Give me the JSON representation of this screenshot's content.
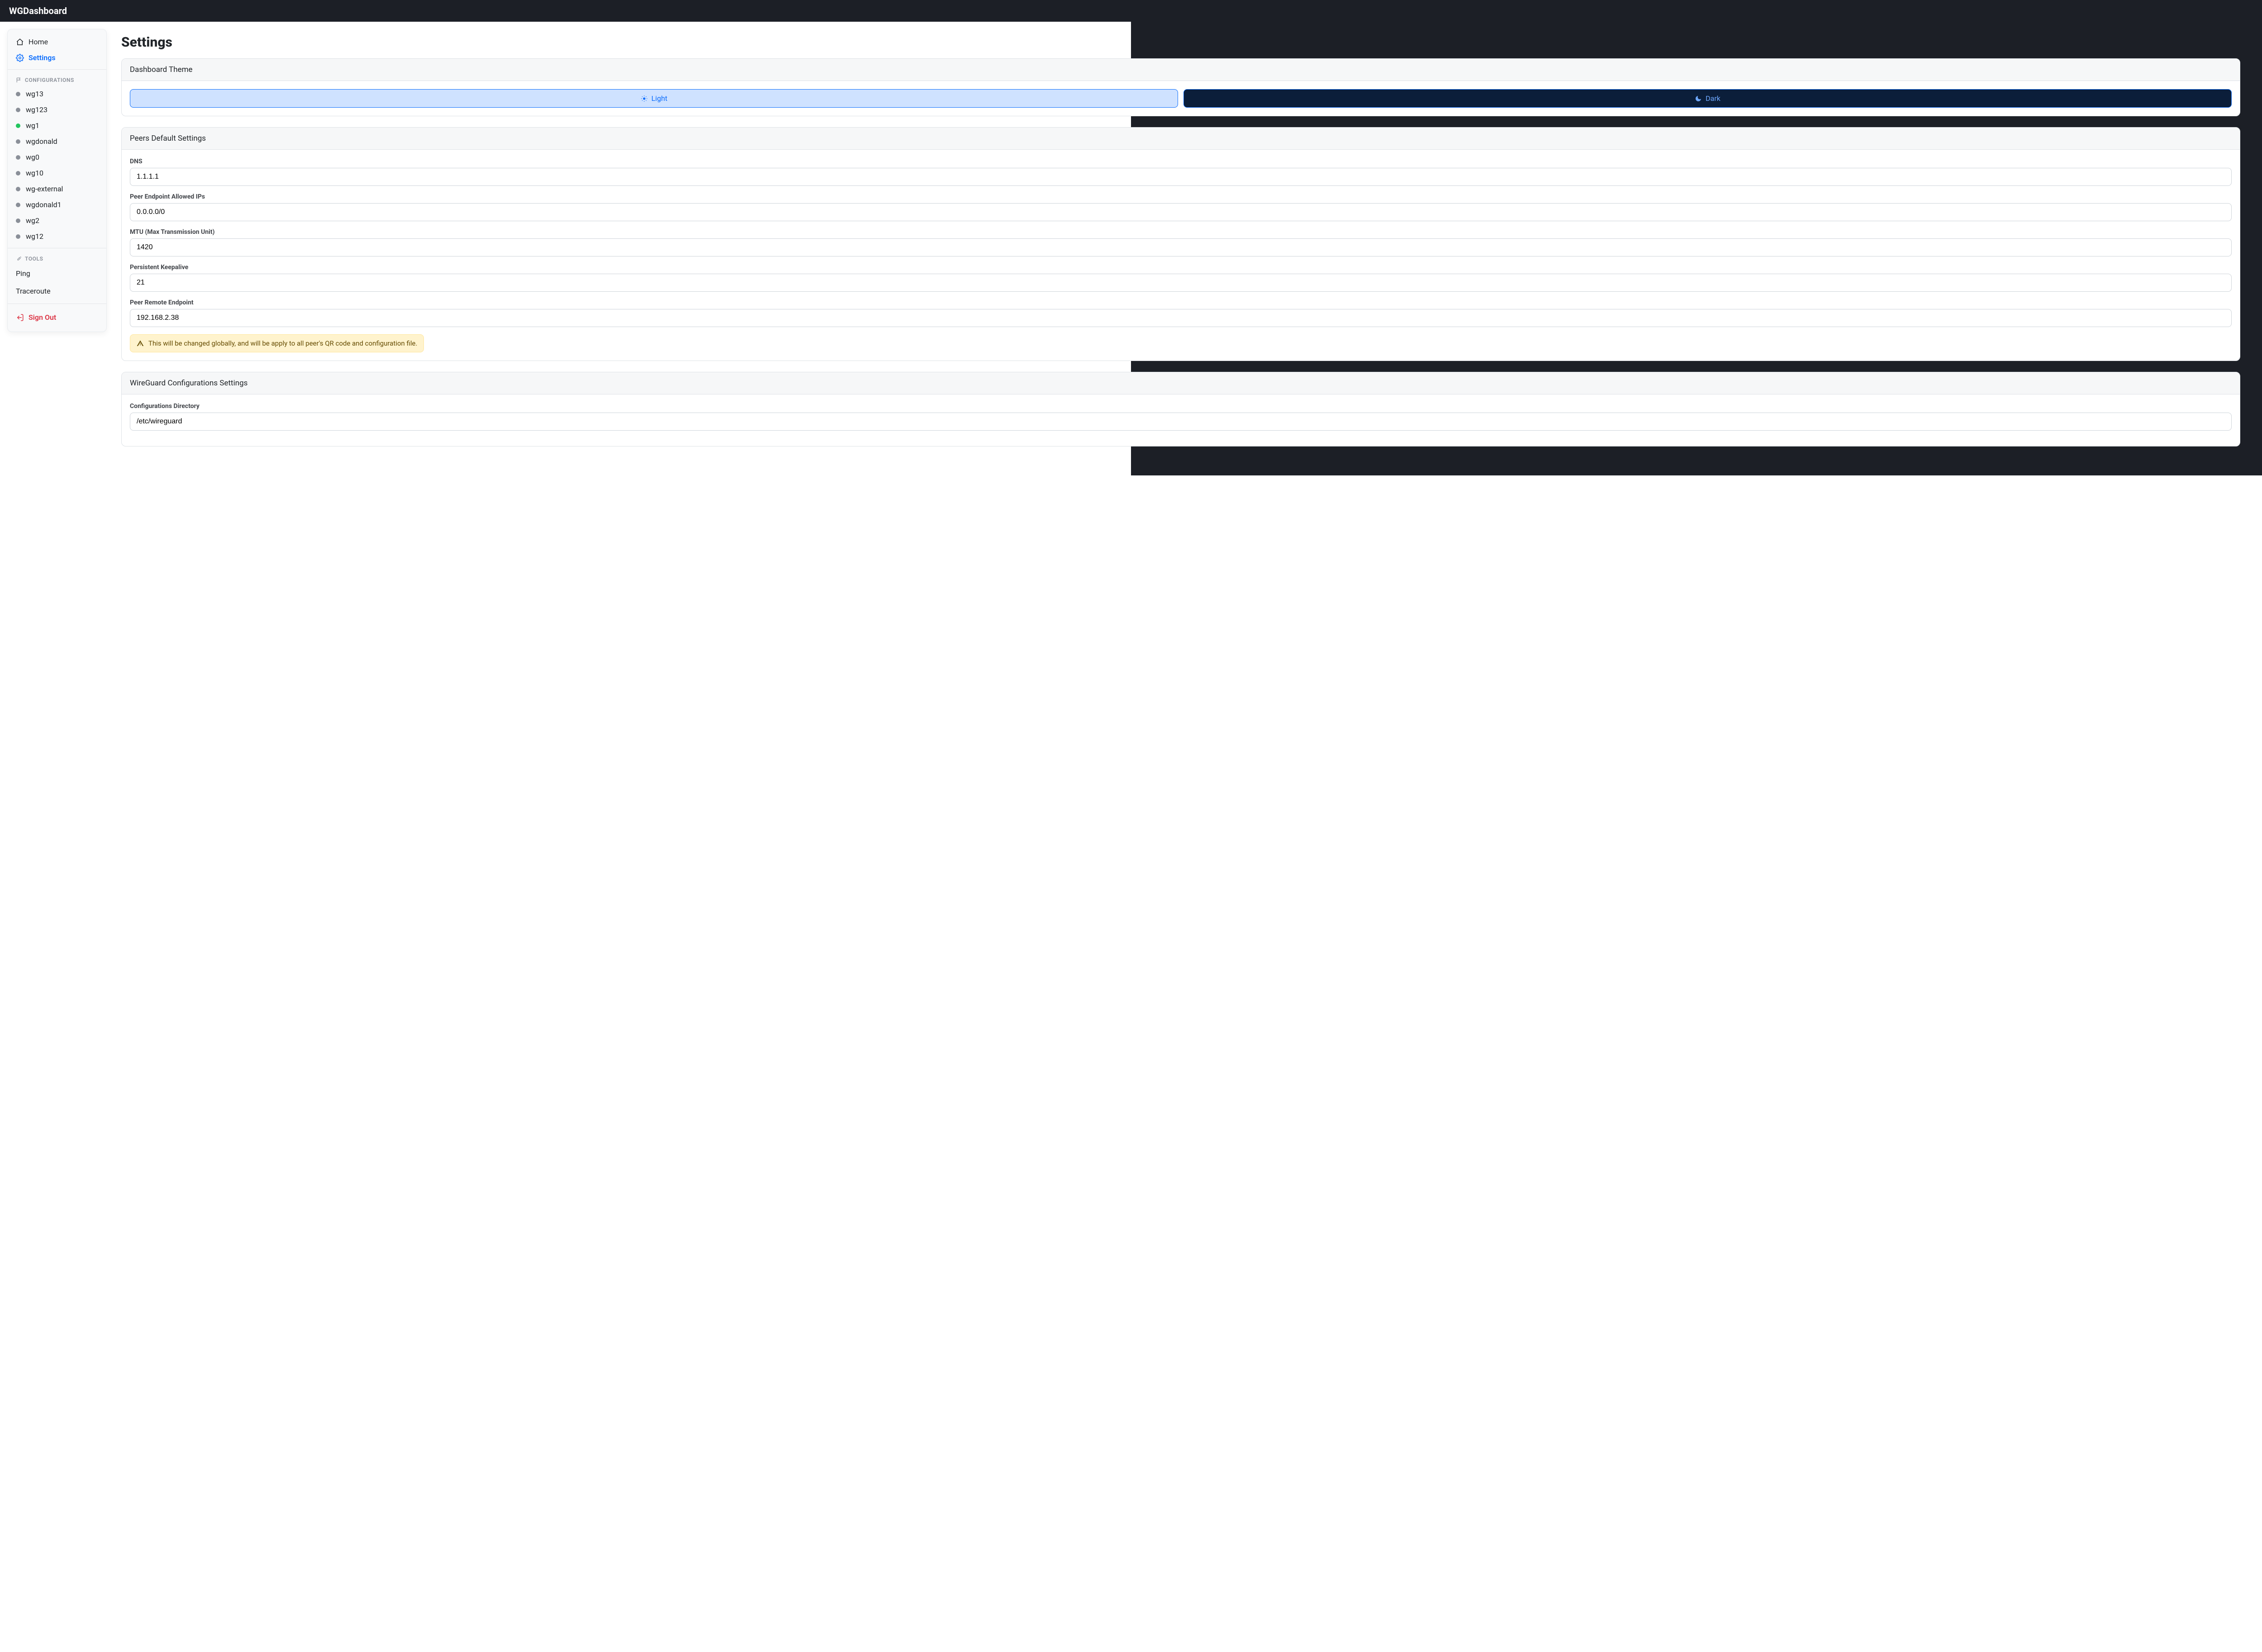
{
  "app": {
    "title": "WGDashboard"
  },
  "sidebar": {
    "nav": {
      "home": "Home",
      "settings": "Settings"
    },
    "configs_header": "CONFIGURATIONS",
    "configs": [
      {
        "name": "wg13",
        "up": false
      },
      {
        "name": "wg123",
        "up": false
      },
      {
        "name": "wg1",
        "up": true
      },
      {
        "name": "wgdonald",
        "up": false
      },
      {
        "name": "wg0",
        "up": false
      },
      {
        "name": "wg10",
        "up": false
      },
      {
        "name": "wg-external",
        "up": false
      },
      {
        "name": "wgdonald1",
        "up": false
      },
      {
        "name": "wg2",
        "up": false
      },
      {
        "name": "wg12",
        "up": false
      }
    ],
    "tools_header": "TOOLS",
    "tools": {
      "ping": "Ping",
      "traceroute": "Traceroute"
    },
    "signout": "Sign Out"
  },
  "page": {
    "title": "Settings"
  },
  "cards": {
    "theme": {
      "header": "Dashboard Theme",
      "light": "Light",
      "dark": "Dark"
    },
    "peers": {
      "header": "Peers Default Settings",
      "dns_label": "DNS",
      "dns_value": "1.1.1.1",
      "allowed_label": "Peer Endpoint Allowed IPs",
      "allowed_value": "0.0.0.0/0",
      "mtu_label": "MTU (Max Transmission Unit)",
      "mtu_value": "1420",
      "keepalive_label": "Persistent Keepalive",
      "keepalive_value": "21",
      "endpoint_label": "Peer Remote Endpoint",
      "endpoint_value": "192.168.2.38",
      "endpoint_alert": "This will be changed globally, and will be apply to all peer's QR code and configuration file."
    },
    "wg": {
      "header": "WireGuard Configurations Settings",
      "dir_label": "Configurations Directory",
      "dir_value": "/etc/wireguard"
    }
  }
}
